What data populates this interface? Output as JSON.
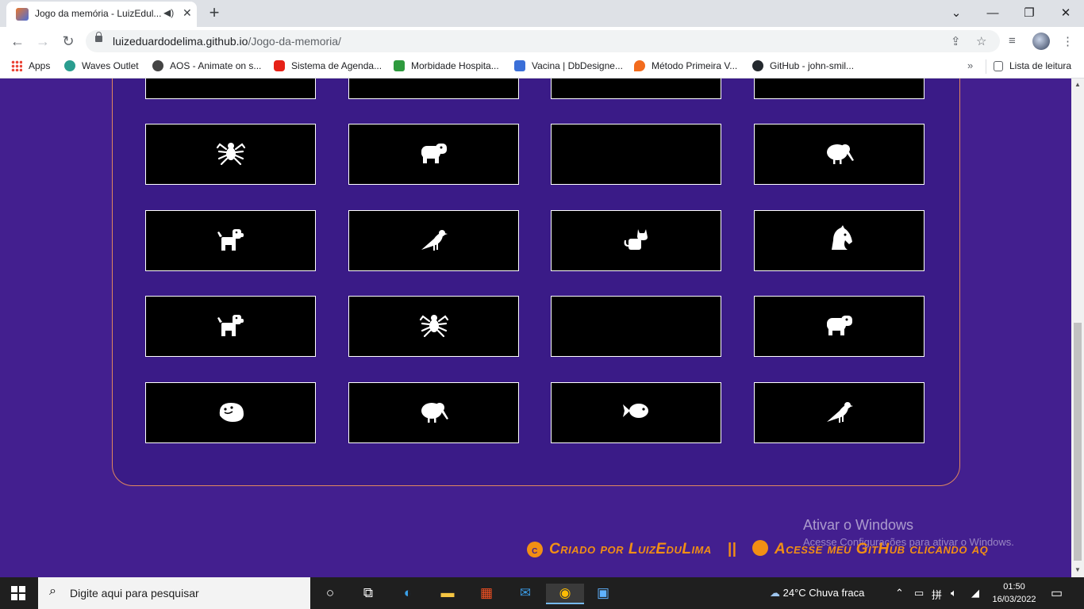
{
  "browser": {
    "tab_title": "Jogo da memória - LuizEdul...",
    "url_domain": "luizeduardodelima.github.io",
    "url_path": "/Jogo-da-memoria/",
    "bookmarks": [
      {
        "label": "Apps",
        "color": "#ea4335"
      },
      {
        "label": "Waves Outlet",
        "color": "#2a9d8f"
      },
      {
        "label": "AOS - Animate on s...",
        "color": "#444444"
      },
      {
        "label": "Sistema de Agenda...",
        "color": "#e62117"
      },
      {
        "label": "Morbidade Hospita...",
        "color": "#2e9a3e"
      },
      {
        "label": "Vacina | DbDesigne...",
        "color": "#3b6fd8"
      },
      {
        "label": "Método Primeira V...",
        "color": "#f26b1d"
      },
      {
        "label": "GitHub - john-smil...",
        "color": "#24292e"
      }
    ],
    "reading_list": "Lista de leitura"
  },
  "game": {
    "cards": [
      {
        "icon": "hidden-card"
      },
      {
        "icon": "hidden-card"
      },
      {
        "icon": "hidden-card"
      },
      {
        "icon": "hidden-card"
      },
      {
        "icon": "spider-icon"
      },
      {
        "icon": "hippo-icon"
      },
      {
        "icon": "hidden-card"
      },
      {
        "icon": "kiwi-bird-icon"
      },
      {
        "icon": "dog-icon"
      },
      {
        "icon": "crow-icon"
      },
      {
        "icon": "cat-icon"
      },
      {
        "icon": "horse-head-icon"
      },
      {
        "icon": "dog-icon"
      },
      {
        "icon": "spider-icon"
      },
      {
        "icon": "hidden-card"
      },
      {
        "icon": "hippo-icon"
      },
      {
        "icon": "otter-icon"
      },
      {
        "icon": "kiwi-bird-icon"
      },
      {
        "icon": "fish-icon"
      },
      {
        "icon": "crow-icon"
      }
    ]
  },
  "watermark": {
    "title": "Ativar o Windows",
    "subtitle": "Acesse Configurações para ativar o Windows."
  },
  "footer": {
    "credit": "Criado por LuizEduLima",
    "separator": "||",
    "github_text": "Acesse meu GitHub clicando aq"
  },
  "taskbar": {
    "search_placeholder": "Digite aqui para pesquisar",
    "weather": "24°C  Chuva fraca",
    "time": "01:50",
    "date": "16/03/2022"
  }
}
